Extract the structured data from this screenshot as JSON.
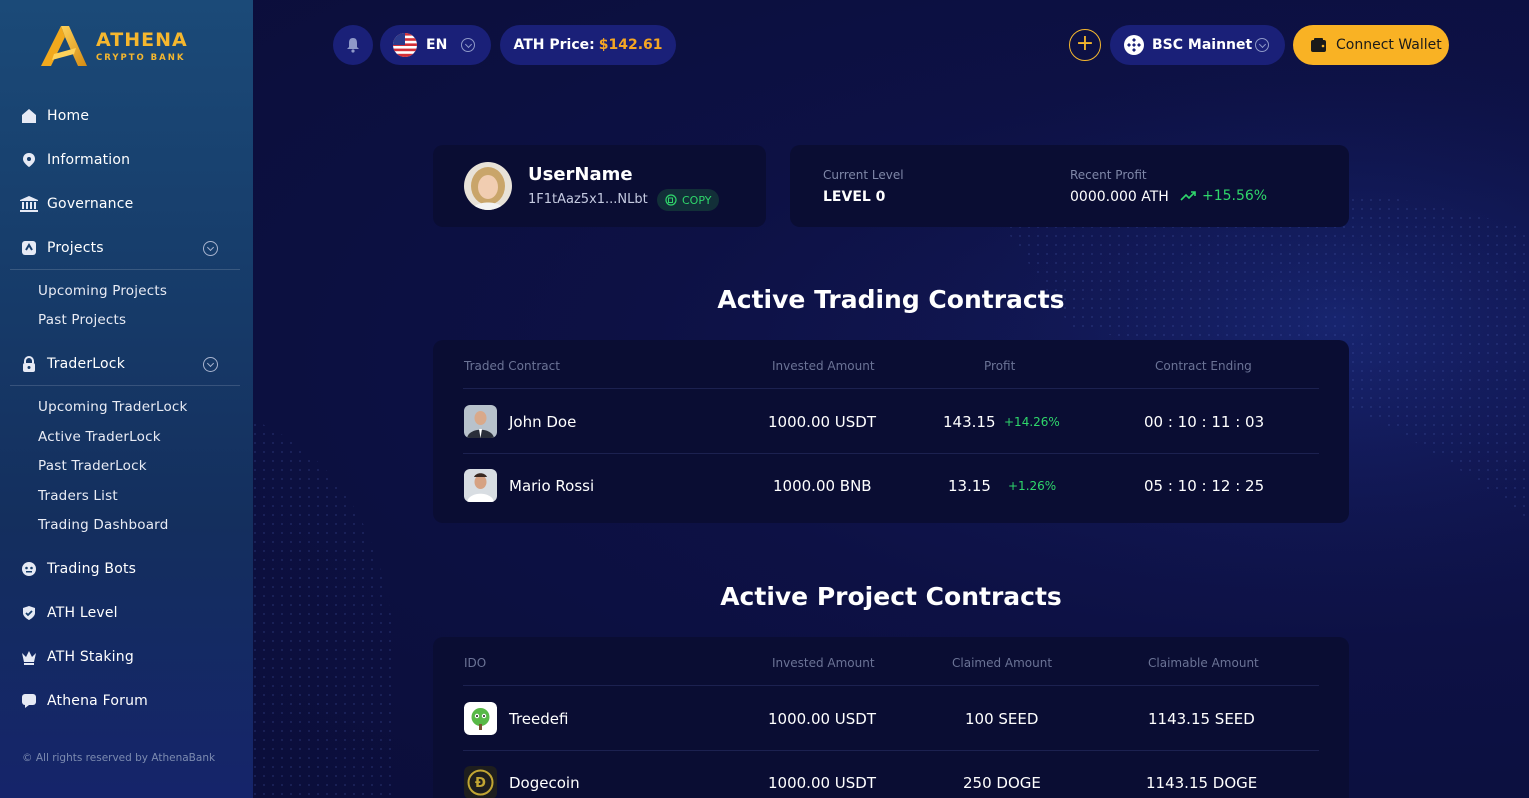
{
  "brand": {
    "name": "ATHENA",
    "tagline": "CRYPTO BANK"
  },
  "sidebar": {
    "items": [
      {
        "label": "Home",
        "icon": "home-icon"
      },
      {
        "label": "Information",
        "icon": "info-icon"
      },
      {
        "label": "Governance",
        "icon": "bank-icon"
      },
      {
        "label": "Projects",
        "icon": "projects-icon"
      },
      {
        "label": "TraderLock",
        "icon": "lock-icon"
      },
      {
        "label": "Trading Bots",
        "icon": "bot-icon"
      },
      {
        "label": "ATH Level",
        "icon": "shield-icon"
      },
      {
        "label": "ATH Staking",
        "icon": "crown-icon"
      },
      {
        "label": "Athena Forum",
        "icon": "chat-icon"
      }
    ],
    "projects_sub": [
      "Upcoming Projects",
      "Past Projects"
    ],
    "traderlock_sub": [
      "Upcoming TraderLock",
      "Active TraderLock",
      "Past TraderLock",
      "Traders List",
      "Trading Dashboard"
    ],
    "copyright": "© All rights reserved by AthenaBank"
  },
  "topbar": {
    "language": "EN",
    "price_label": "ATH Price:",
    "price_value": "$142.61",
    "network": "BSC Mainnet",
    "connect": "Connect Wallet"
  },
  "user": {
    "name": "UserName",
    "address": "1F1tAaz5x1...NLbt",
    "copy_label": "COPY"
  },
  "stats": {
    "level_label": "Current Level",
    "level_value": "LEVEL 0",
    "profit_label": "Recent Profit",
    "profit_value": "0000.000 ATH",
    "profit_change": "+15.56%"
  },
  "trading": {
    "title": "Active Trading Contracts",
    "headers": [
      "Traded Contract",
      "Invested Amount",
      "Profit",
      "Contract Ending"
    ],
    "rows": [
      {
        "name": "John Doe",
        "invested": "1000.00 USDT",
        "profit": "143.15",
        "pct": "+14.26%",
        "ending": "00 : 10 : 11 : 03"
      },
      {
        "name": "Mario Rossi",
        "invested": "1000.00 BNB",
        "profit": "13.15",
        "pct": "+1.26%",
        "ending": "05 : 10 : 12 : 25"
      }
    ]
  },
  "projects": {
    "title": "Active Project Contracts",
    "headers": [
      "IDO",
      "Invested Amount",
      "Claimed Amount",
      "Claimable Amount"
    ],
    "rows": [
      {
        "name": "Treedefi",
        "invested": "1000.00 USDT",
        "claimed": "100 SEED",
        "claimable": "1143.15 SEED"
      },
      {
        "name": "Dogecoin",
        "invested": "1000.00 USDT",
        "claimed": "250 DOGE",
        "claimable": "1143.15 DOGE"
      }
    ]
  },
  "colors": {
    "accent": "#f9b224",
    "positive": "#2fd66b",
    "bg": "#0c0f3c"
  }
}
